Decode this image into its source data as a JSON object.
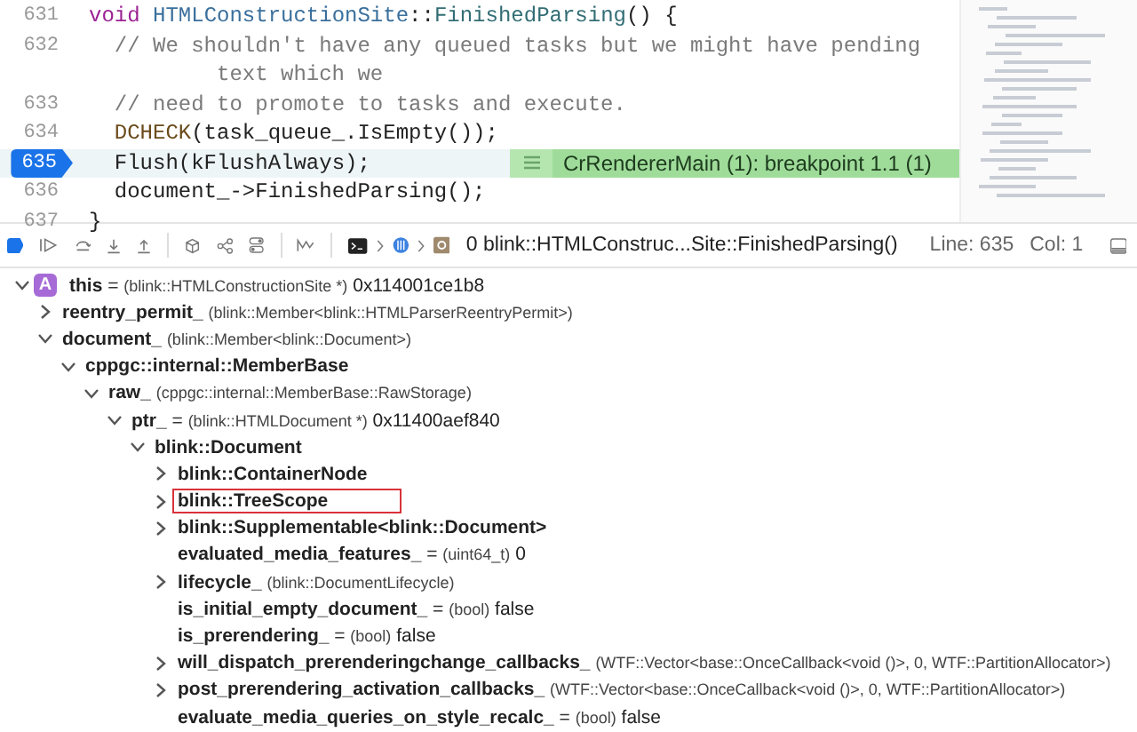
{
  "code": {
    "lines": [
      {
        "number": "631",
        "current": false,
        "tokens": [
          {
            "kind": "keyword",
            "text": "void "
          },
          {
            "kind": "type",
            "text": "HTMLConstructionSite"
          },
          {
            "kind": "plain",
            "text": "::"
          },
          {
            "kind": "function",
            "text": "FinishedParsing"
          },
          {
            "kind": "plain",
            "text": "() {"
          }
        ]
      },
      {
        "number": "632",
        "current": false,
        "tokens": [
          {
            "kind": "comment",
            "text": "  // We shouldn't have any queued tasks but we might have pending"
          }
        ],
        "continuation": "text which we"
      },
      {
        "number": "633",
        "current": false,
        "tokens": [
          {
            "kind": "comment",
            "text": "  // need to promote to tasks and execute."
          }
        ]
      },
      {
        "number": "634",
        "current": false,
        "tokens": [
          {
            "kind": "macro",
            "text": "  DCHECK"
          },
          {
            "kind": "plain",
            "text": "(task_queue_.IsEmpty());"
          }
        ]
      },
      {
        "number": "635",
        "current": true,
        "tokens": [
          {
            "kind": "plain",
            "text": "  Flush(kFlushAlways);"
          }
        ],
        "annotation": "CrRendererMain (1): breakpoint 1.1 (1)"
      },
      {
        "number": "636",
        "current": false,
        "tokens": [
          {
            "kind": "plain",
            "text": "  document_->FinishedParsing();"
          }
        ]
      },
      {
        "number": "637",
        "current": false,
        "tokens": [
          {
            "kind": "plain",
            "text": "}"
          }
        ]
      }
    ]
  },
  "debug_bar": {
    "frame": "0 blink::HTMLConstruc...Site::FinishedParsing()",
    "line": "Line: 635",
    "column": "Col: 1"
  },
  "variables": [
    {
      "badge": "A",
      "name": "this",
      "separator": " = ",
      "type": "(blink::HTMLConstructionSite *)",
      "value": "0x114001ce1b8",
      "expanded": true,
      "children": [
        {
          "name": "reentry_permit_",
          "type": "(blink::Member<blink::HTMLParserReentryPermit>)",
          "expanded": false
        },
        {
          "name": "document_",
          "type": "(blink::Member<blink::Document>)",
          "expanded": true,
          "children": [
            {
              "name": "cppgc::internal::MemberBase",
              "expanded": true,
              "children": [
                {
                  "name": "raw_",
                  "type": "(cppgc::internal::MemberBase::RawStorage)",
                  "expanded": true,
                  "children": [
                    {
                      "name": "ptr_",
                      "separator": " = ",
                      "type": "(blink::HTMLDocument *)",
                      "value": "0x11400aef840",
                      "expanded": true,
                      "children": [
                        {
                          "name": "blink::Document",
                          "expanded": true,
                          "children": [
                            {
                              "name": "blink::ContainerNode",
                              "expanded": false
                            },
                            {
                              "name": "blink::TreeScope",
                              "expanded": false,
                              "highlighted": true
                            },
                            {
                              "name": "blink::Supplementable<blink::Document>",
                              "expanded": false
                            },
                            {
                              "name": "evaluated_media_features_",
                              "separator": " = ",
                              "type": "(uint64_t)",
                              "value": "0"
                            },
                            {
                              "name": "lifecycle_",
                              "type": "(blink::DocumentLifecycle)",
                              "expanded": false
                            },
                            {
                              "name": "is_initial_empty_document_",
                              "separator": " = ",
                              "type": "(bool)",
                              "value": "false"
                            },
                            {
                              "name": "is_prerendering_",
                              "separator": " = ",
                              "type": "(bool)",
                              "value": "false"
                            },
                            {
                              "name": "will_dispatch_prerenderingchange_callbacks_",
                              "type": "(WTF::Vector<base::OnceCallback<void ()>, 0, WTF::PartitionAllocator>)",
                              "expanded": false
                            },
                            {
                              "name": "post_prerendering_activation_callbacks_",
                              "type": "(WTF::Vector<base::OnceCallback<void ()>, 0, WTF::PartitionAllocator>)",
                              "expanded": false
                            },
                            {
                              "name": "evaluate_media_queries_on_style_recalc_",
                              "separator": " = ",
                              "type": "(bool)",
                              "value": "false"
                            }
                          ]
                        }
                      ]
                    }
                  ]
                }
              ]
            }
          ]
        }
      ]
    }
  ]
}
